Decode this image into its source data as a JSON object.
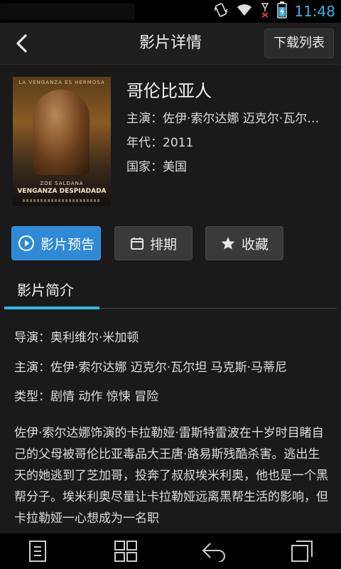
{
  "status_bar": {
    "time": "11:48",
    "icons": [
      "vibrate-icon",
      "wifi-icon",
      "no-signal-icon",
      "battery-charging-icon"
    ]
  },
  "header": {
    "back_icon": "back-chevron-icon",
    "title": "影片详情",
    "download_list_label": "下载列表"
  },
  "movie": {
    "poster_tagline": "LA VENGANZA ES HERMOSA",
    "poster_actor": "ZOE SALDANA",
    "poster_title": "VENGANZA DESPIADADA",
    "title": "哥伦比亚人",
    "starring_short": "主演：佐伊·索尔达娜  迈克尔·瓦尔…",
    "year": "年代：2011",
    "country": "国家：美国"
  },
  "actions": {
    "trailer_label": "影片预告",
    "schedule_label": "排期",
    "favorite_label": "收藏"
  },
  "tabs": {
    "intro_label": "影片简介"
  },
  "details": {
    "director": "导演：奥利维尔·米加顿",
    "starring": "主演：佐伊·索尔达娜  迈克尔·瓦尔坦  马克斯·马蒂尼",
    "genre": "类型：剧情  动作  惊悚  冒险",
    "synopsis": "佐伊·索尔达娜饰演的卡拉勒娅·雷斯特雷波在十岁时目睹自己的父母被哥伦比亚毒品大王唐·路易斯残酷杀害。逃出生天的她逃到了芝加哥，投奔了叔叔埃米利奥，他也是一个黑帮分子。埃米利奥尽量让卡拉勒娅远离黑帮生活的影响，但卡拉勒娅一心想成为一名职"
  },
  "nav_bar": {
    "icons": [
      "menu-icon",
      "apps-icon",
      "back-icon",
      "recents-icon"
    ]
  },
  "colors": {
    "accent": "#33b5e5",
    "primary_button": "#2f89d4",
    "background": "#1a1a1a"
  }
}
